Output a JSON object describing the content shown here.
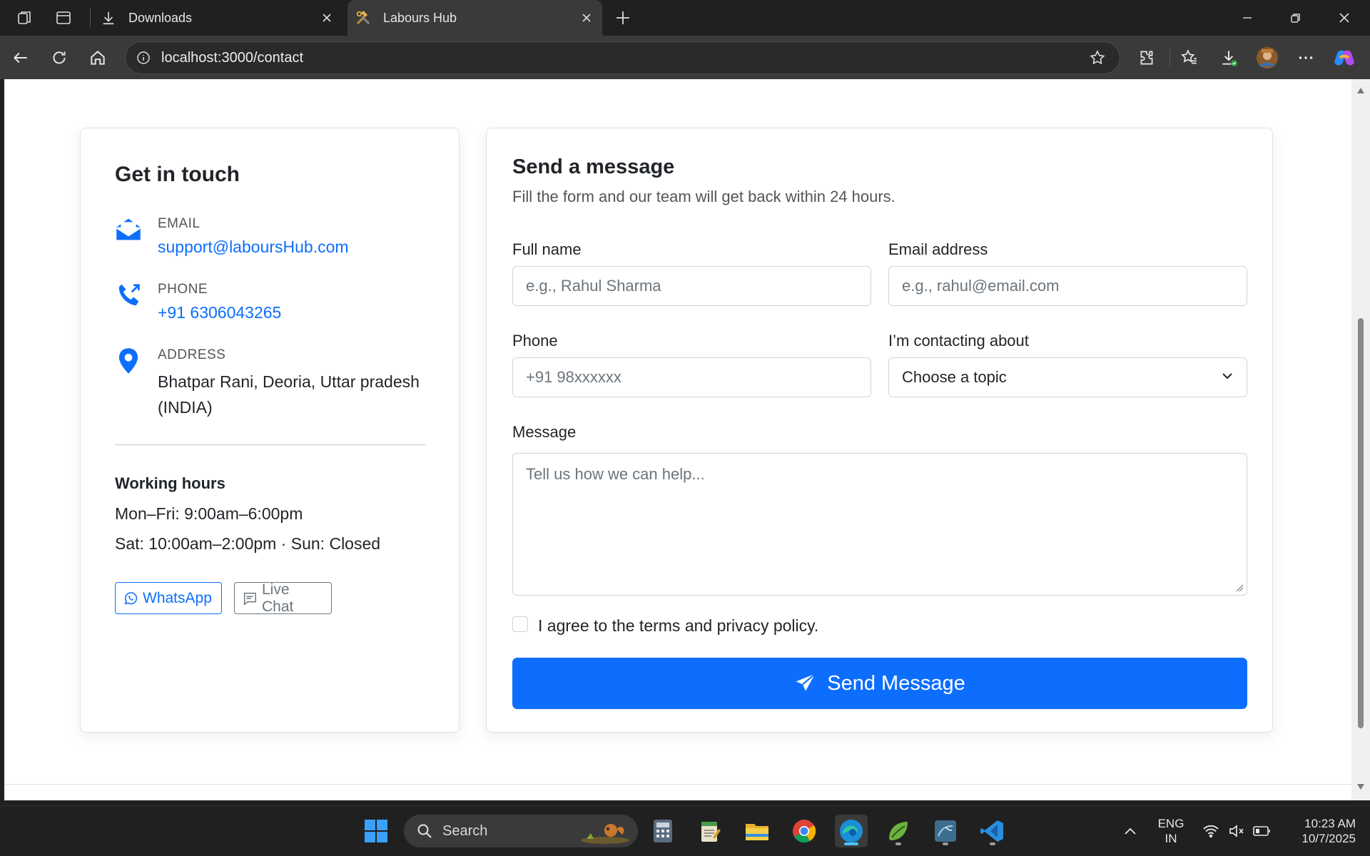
{
  "browser": {
    "tabs": [
      {
        "title": "Downloads",
        "active": false,
        "icon": "download-icon"
      },
      {
        "title": "Labours Hub",
        "active": true,
        "icon": "hammer-wrench-icon"
      }
    ],
    "address": "localhost:3000/contact"
  },
  "contact_info": {
    "heading": "Get in touch",
    "email": {
      "label": "EMAIL",
      "value": "support@laboursHub.com",
      "icon": "envelope-icon"
    },
    "phone": {
      "label": "PHONE",
      "value": "+91 6306043265",
      "icon": "phone-icon"
    },
    "address": {
      "label": "ADDRESS",
      "value": "Bhatpar Rani, Deoria, Uttar pradesh (INDIA)",
      "icon": "map-pin-icon"
    },
    "hours_title": "Working hours",
    "hours_weekday": "Mon–Fri: 9:00am–6:00pm",
    "hours_weekend": "Sat: 10:00am–2:00pm · Sun: Closed",
    "whatsapp_label": "WhatsApp",
    "livechat_label": "Live Chat"
  },
  "form": {
    "heading": "Send a message",
    "subtitle": "Fill the form and our team will get back within 24 hours.",
    "full_name": {
      "label": "Full name",
      "placeholder": "e.g., Rahul Sharma"
    },
    "email": {
      "label": "Email address",
      "placeholder": "e.g., rahul@email.com"
    },
    "phone": {
      "label": "Phone",
      "placeholder": "+91 98xxxxxx"
    },
    "topic": {
      "label": "I’m contacting about",
      "value": "Choose a topic"
    },
    "message": {
      "label": "Message",
      "placeholder": "Tell us how we can help..."
    },
    "agree_label": "I agree to the terms and privacy policy.",
    "agree_checked": false,
    "submit_label": "Send Message"
  },
  "taskbar": {
    "search_label": "Search",
    "lang_line1": "ENG",
    "lang_line2": "IN",
    "time": "10:23 AM",
    "date": "10/7/2025"
  },
  "colors": {
    "primary": "#0d6efd",
    "text": "#212529",
    "muted": "#6c757d"
  }
}
